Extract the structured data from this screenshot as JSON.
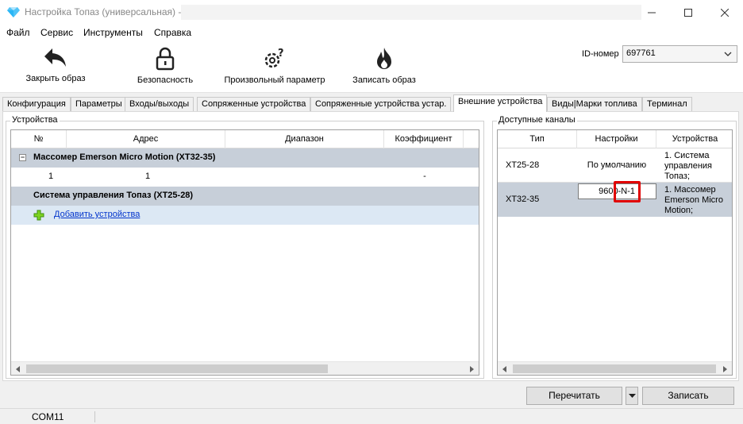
{
  "window": {
    "title": "Настройка Топаз (универсальная) -"
  },
  "menu": [
    "Файл",
    "Сервис",
    "Инструменты",
    "Справка"
  ],
  "toolbar": {
    "close_image": "Закрыть образ",
    "security": "Безопасность",
    "custom_param": "Произвольный параметр",
    "write_image": "Записать образ",
    "id_label": "ID-номер",
    "id_value": "697761"
  },
  "tabs": [
    "Конфигурация",
    "Параметры",
    "Входы/выходы",
    "Сопряженные устройства",
    "Сопряженные устройства устар.",
    "Внешние устройства",
    "Виды|Марки топлива",
    "Терминал"
  ],
  "active_tab": "Внешние устройства",
  "devices": {
    "group_title": "Устройства",
    "columns": [
      "№",
      "Адрес",
      "Диапазон",
      "Коэффициент"
    ],
    "group1": "Массомер Emerson Micro Motion (XT32-35)",
    "row1": {
      "num": "1",
      "address": "1",
      "range": "",
      "coef": "-"
    },
    "group2": "Система управления Топаз (XT25-28)",
    "add_link": "Добавить устройства"
  },
  "channels": {
    "group_title": "Доступные каналы",
    "columns": [
      "Тип",
      "Настройки",
      "Устройства"
    ],
    "rows": [
      {
        "type": "XT25-28",
        "settings": "По умолчанию",
        "devices": "1. Система управления Топаз;"
      },
      {
        "type": "XT32-35",
        "settings": "9600-N-1",
        "devices": "1. Массомер Emerson Micro Motion;"
      }
    ]
  },
  "buttons": {
    "reread": "Перечитать",
    "write": "Записать"
  },
  "status": {
    "port": "COM11"
  },
  "colors": {
    "group_row": "#c7cfd9",
    "add_row": "#dce8f4",
    "selected_row": "#c7cfd9",
    "highlight": "#e00000",
    "link": "#0033cc"
  }
}
